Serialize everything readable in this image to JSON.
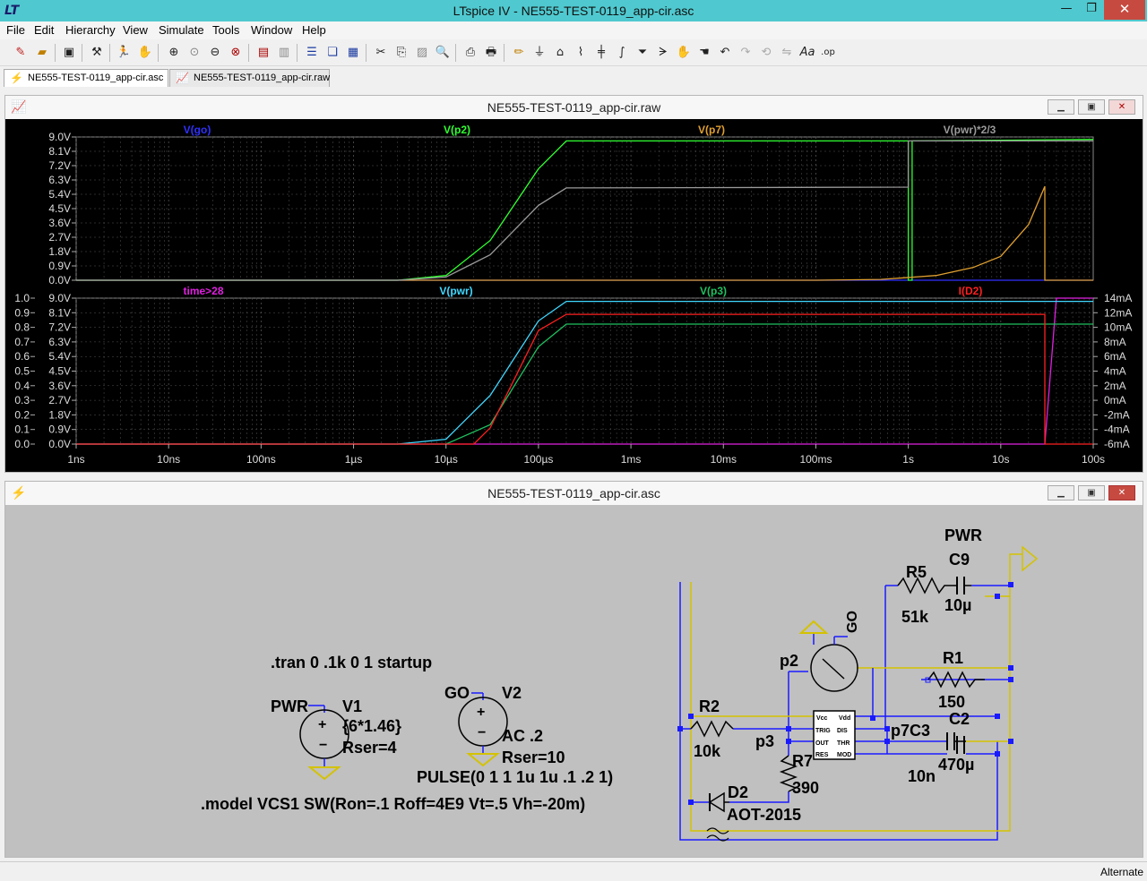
{
  "window": {
    "title": "LTspice IV - NE555-TEST-0119_app-cir.asc"
  },
  "menu": [
    "File",
    "Edit",
    "Hierarchy",
    "View",
    "Simulate",
    "Tools",
    "Window",
    "Help"
  ],
  "tabs": [
    {
      "label": "NE555-TEST-0119_app-cir.asc"
    },
    {
      "label": "NE555-TEST-0119_app-cir.raw"
    }
  ],
  "waveform_window": {
    "title": "NE555-TEST-0119_app-cir.raw"
  },
  "schematic_window": {
    "title": "NE555-TEST-0119_app-cir.asc"
  },
  "status": {
    "text": "Alternate"
  },
  "colors": {
    "go": "#3030ff",
    "p2": "#30ff30",
    "p7": "#e0a030",
    "pwr23": "#9a9a9a",
    "time28": "#e020e0",
    "pwr": "#40d8ff",
    "p3": "#20c060",
    "iD2": "#ff2020"
  },
  "chart_data": [
    {
      "type": "line",
      "pane": "top",
      "x_scale": "log",
      "xlim": [
        "1ns",
        "100s"
      ],
      "ylim": [
        0,
        9.0
      ],
      "y_ticks": [
        "9.0V",
        "8.1V",
        "7.2V",
        "6.3V",
        "5.4V",
        "4.5V",
        "3.6V",
        "2.7V",
        "1.8V",
        "0.9V",
        "0.0V"
      ],
      "legend": [
        "V(go)",
        "V(p2)",
        "V(p7)",
        "V(pwr)*2/3"
      ],
      "series": [
        {
          "name": "V(go)",
          "x_s": [
            1e-09,
            100
          ],
          "y": [
            0,
            0
          ]
        },
        {
          "name": "V(p2)",
          "x_s": [
            1e-09,
            3e-06,
            1e-05,
            3e-05,
            0.0001,
            0.0002,
            1.0,
            1.0,
            1.1,
            1.1,
            100
          ],
          "y": [
            0,
            0,
            0.3,
            2.5,
            7.0,
            8.75,
            8.75,
            0.0,
            0.0,
            8.75,
            8.85
          ]
        },
        {
          "name": "V(p7)",
          "x_s": [
            1e-09,
            3e-06,
            0.1,
            0.5,
            2,
            5,
            10,
            20,
            30,
            30,
            100
          ],
          "y": [
            0,
            0,
            0,
            0.05,
            0.3,
            0.8,
            1.5,
            3.5,
            5.9,
            0,
            0
          ]
        },
        {
          "name": "V(pwr)*2/3",
          "x_s": [
            1e-09,
            3e-06,
            1e-05,
            3e-05,
            0.0001,
            0.0002,
            1.0,
            1.0,
            100
          ],
          "y": [
            0,
            0,
            0.2,
            1.6,
            4.7,
            5.8,
            5.85,
            8.75,
            8.75
          ]
        }
      ],
      "x_ticks": [
        "1ns",
        "10ns",
        "100ns",
        "1µs",
        "10µs",
        "100µs",
        "1ms",
        "10ms",
        "100ms",
        "1s",
        "10s",
        "100s"
      ]
    },
    {
      "type": "line",
      "pane": "bottom",
      "x_scale": "log",
      "xlim": [
        "1ns",
        "100s"
      ],
      "y_ticks_left1": [
        "1.0",
        "0.9",
        "0.8",
        "0.7",
        "0.6",
        "0.5",
        "0.4",
        "0.3",
        "0.2",
        "0.1",
        "0.0"
      ],
      "y_ticks_left2": [
        "9.0V",
        "8.1V",
        "7.2V",
        "6.3V",
        "5.4V",
        "4.5V",
        "3.6V",
        "2.7V",
        "1.8V",
        "0.9V",
        "0.0V"
      ],
      "y_ticks_right": [
        "14mA",
        "12mA",
        "10mA",
        "8mA",
        "6mA",
        "4mA",
        "2mA",
        "0mA",
        "-2mA",
        "-4mA",
        "-6mA"
      ],
      "legend": [
        "time>28",
        "V(pwr)",
        "V(p3)",
        "I(D2)"
      ],
      "series": [
        {
          "name": "time>28",
          "x_s": [
            1e-09,
            30,
            40,
            100
          ],
          "y": [
            0,
            0,
            1,
            1
          ]
        },
        {
          "name": "V(pwr)",
          "x_s": [
            1e-09,
            3e-06,
            1e-05,
            3e-05,
            0.0001,
            0.0002,
            100
          ],
          "y": [
            0,
            0,
            0.3,
            3.0,
            7.6,
            8.8,
            8.8
          ]
        },
        {
          "name": "V(p3)",
          "x_s": [
            1e-09,
            1e-05,
            3e-05,
            0.0001,
            0.0002,
            100
          ],
          "y": [
            0,
            0,
            1.2,
            6.0,
            7.4,
            7.4
          ]
        },
        {
          "name": "I(D2)",
          "x_s": [
            1e-09,
            2e-05,
            3e-05,
            0.0001,
            0.0002,
            30,
            30,
            100
          ],
          "y": [
            0,
            0,
            1.0,
            7.0,
            8.0,
            8.0,
            0,
            0
          ]
        }
      ],
      "x_ticks": [
        "1ns",
        "10ns",
        "100ns",
        "1µs",
        "10µs",
        "100µs",
        "1ms",
        "10ms",
        "100ms",
        "1s",
        "10s",
        "100s"
      ]
    }
  ],
  "schematic": {
    "directive_tran": ".tran 0 .1k 0 1 startup",
    "v1": {
      "net": "PWR",
      "name": "V1",
      "value": "{6*1.46}",
      "rser": "Rser=4"
    },
    "v2": {
      "net": "GO",
      "name": "V2",
      "value": "AC .2",
      "rser": "Rser=10",
      "pulse": "PULSE(0 1 1 1u 1u .1 .2 1)"
    },
    "model": ".model VCS1 SW(Ron=.1 Roff=4E9 Vt=.5 Vh=-20m)",
    "pwr_label": "PWR",
    "r5": {
      "name": "R5",
      "value": "51k"
    },
    "c9": {
      "name": "C9",
      "value": "10µ"
    },
    "go_label": "GO",
    "p2_label": "p2",
    "r1": {
      "name": "R1",
      "value": "150"
    },
    "r2": {
      "name": "R2",
      "value": "10k"
    },
    "c2": {
      "name": "C2",
      "value": "470µ"
    },
    "p7c3": "p7C3",
    "p3_label": "p3",
    "r7": {
      "name": "R7",
      "value": "390"
    },
    "c3_value": "10n",
    "d2": {
      "name": "D2",
      "value": "AOT-2015"
    },
    "ic_pins": {
      "vcc": "Vcc",
      "vdd": "Vdd",
      "trig": "TRIG",
      "dis": "DIS",
      "out": "OUT",
      "thr": "THR",
      "res": "RES",
      "mod": "MOD"
    }
  }
}
